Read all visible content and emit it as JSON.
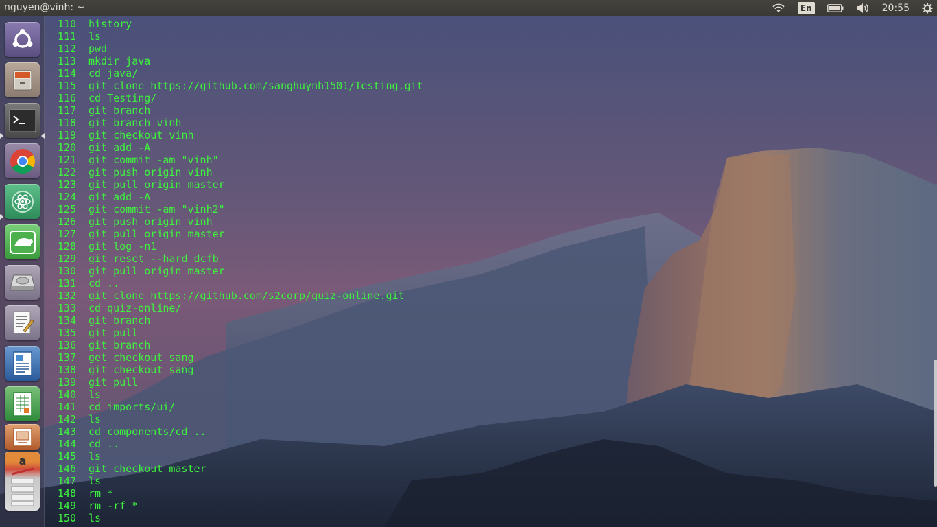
{
  "panel": {
    "window_title": "nguyen@vinh: ~",
    "indicators": {
      "wifi": "wifi-icon",
      "keyboard_layout": "En",
      "battery": "battery-icon",
      "volume": "volume-icon",
      "clock": "20:55",
      "session": "gear-icon"
    }
  },
  "launcher": {
    "items": [
      {
        "name": "dash-home",
        "icon": "ubuntu-logo-icon"
      },
      {
        "name": "files",
        "icon": "file-cabinet-icon"
      },
      {
        "name": "terminal",
        "icon": "terminal-icon",
        "running": true,
        "focused": true
      },
      {
        "name": "chrome",
        "icon": "chrome-icon"
      },
      {
        "name": "atom",
        "icon": "atom-icon",
        "running": true
      },
      {
        "name": "app-green",
        "icon": "turtle-icon"
      },
      {
        "name": "disk",
        "icon": "hard-drive-icon"
      },
      {
        "name": "text-editor",
        "icon": "text-editor-icon"
      },
      {
        "name": "writer",
        "icon": "document-icon"
      },
      {
        "name": "calc",
        "icon": "spreadsheet-icon"
      },
      {
        "name": "impress",
        "icon": "presentation-icon"
      },
      {
        "name": "stacked",
        "icon": "stacked-apps-icon"
      }
    ]
  },
  "terminal": {
    "history": [
      {
        "n": "110",
        "cmd": "history"
      },
      {
        "n": "111",
        "cmd": "ls"
      },
      {
        "n": "112",
        "cmd": "pwd"
      },
      {
        "n": "113",
        "cmd": "mkdir java"
      },
      {
        "n": "114",
        "cmd": "cd java/"
      },
      {
        "n": "115",
        "cmd": "git clone https://github.com/sanghuynh1501/Testing.git"
      },
      {
        "n": "116",
        "cmd": "cd Testing/"
      },
      {
        "n": "117",
        "cmd": "git branch"
      },
      {
        "n": "118",
        "cmd": "git branch vinh"
      },
      {
        "n": "119",
        "cmd": "git checkout vinh"
      },
      {
        "n": "120",
        "cmd": "git add -A"
      },
      {
        "n": "121",
        "cmd": "git commit -am \"vinh\""
      },
      {
        "n": "122",
        "cmd": "git push origin vinh"
      },
      {
        "n": "123",
        "cmd": "git pull origin master"
      },
      {
        "n": "124",
        "cmd": "git add -A"
      },
      {
        "n": "125",
        "cmd": "git commit -am \"vinh2\""
      },
      {
        "n": "126",
        "cmd": "git push origin vinh"
      },
      {
        "n": "127",
        "cmd": "git pull origin master"
      },
      {
        "n": "128",
        "cmd": "git log -n1"
      },
      {
        "n": "129",
        "cmd": "git reset --hard dcfb"
      },
      {
        "n": "130",
        "cmd": "git pull origin master"
      },
      {
        "n": "131",
        "cmd": "cd .."
      },
      {
        "n": "132",
        "cmd": "git clone https://github.com/s2corp/quiz-online.git"
      },
      {
        "n": "133",
        "cmd": "cd quiz-online/"
      },
      {
        "n": "134",
        "cmd": "git branch"
      },
      {
        "n": "135",
        "cmd": "git pull"
      },
      {
        "n": "136",
        "cmd": "git branch"
      },
      {
        "n": "137",
        "cmd": "get checkout sang"
      },
      {
        "n": "138",
        "cmd": "git checkout sang"
      },
      {
        "n": "139",
        "cmd": "git pull"
      },
      {
        "n": "140",
        "cmd": "ls"
      },
      {
        "n": "141",
        "cmd": "cd imports/ui/"
      },
      {
        "n": "142",
        "cmd": "ls"
      },
      {
        "n": "143",
        "cmd": "cd components/cd .."
      },
      {
        "n": "144",
        "cmd": "cd .."
      },
      {
        "n": "145",
        "cmd": "ls"
      },
      {
        "n": "146",
        "cmd": "git checkout master"
      },
      {
        "n": "147",
        "cmd": "ls"
      },
      {
        "n": "148",
        "cmd": "rm *"
      },
      {
        "n": "149",
        "cmd": "rm -rf *"
      },
      {
        "n": "150",
        "cmd": "ls"
      }
    ]
  },
  "colors": {
    "terminal_text": "#3ef23e",
    "panel_bg": "#3a3935"
  }
}
